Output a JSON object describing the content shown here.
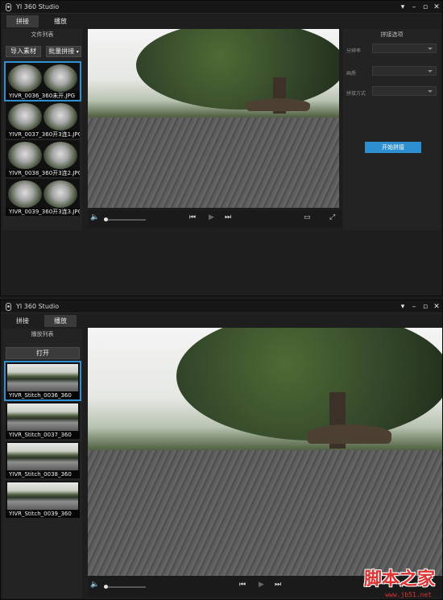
{
  "window1": {
    "title": "YI 360 Studio",
    "tabs": [
      {
        "label": "拼接",
        "active": true
      },
      {
        "label": "播放",
        "active": false
      }
    ],
    "left_panel": {
      "header": "文件列表",
      "import_button": "导入素材",
      "batch_button": "批量拼接",
      "files": [
        {
          "name": "YIVR_0036_360未开.JPG",
          "selected": true
        },
        {
          "name": "YIVR_0037_360开3连1.JPG",
          "selected": false
        },
        {
          "name": "YIVR_0038_360开3连2.JPG",
          "selected": false
        },
        {
          "name": "YIVR_0039_360开3连3.JPG",
          "selected": false
        }
      ]
    },
    "right_panel": {
      "header": "拼接选项",
      "options": [
        {
          "label": "分辨率",
          "value": ""
        },
        {
          "label": "画质",
          "value": ""
        },
        {
          "label": "拼接方式",
          "value": ""
        }
      ],
      "start_button": "开始拼接"
    }
  },
  "window2": {
    "title": "YI 360 Studio",
    "tabs": [
      {
        "label": "拼接",
        "active": false
      },
      {
        "label": "播放",
        "active": true
      }
    ],
    "left_panel": {
      "header": "播放列表",
      "open_button": "打开",
      "files": [
        {
          "name": "YIVR_Stitch_0036_360",
          "selected": true
        },
        {
          "name": "YIVR_Stitch_0037_360",
          "selected": false
        },
        {
          "name": "YIVR_Stitch_0038_360",
          "selected": false
        },
        {
          "name": "YIVR_Stitch_0039_360",
          "selected": false
        }
      ]
    }
  },
  "icons": {
    "minimize": "minimize-icon",
    "restore": "restore-icon",
    "close": "close-icon",
    "volume": "volume-icon",
    "prev": "previous-icon",
    "play": "play-icon",
    "next": "next-icon",
    "fit": "fit-window-icon",
    "fullscreen": "fullscreen-icon"
  },
  "watermark": {
    "text": "脚本之家",
    "url": "www.jb51.net"
  },
  "colors": {
    "accent": "#2d8fd0",
    "background": "#1e1e1e"
  }
}
